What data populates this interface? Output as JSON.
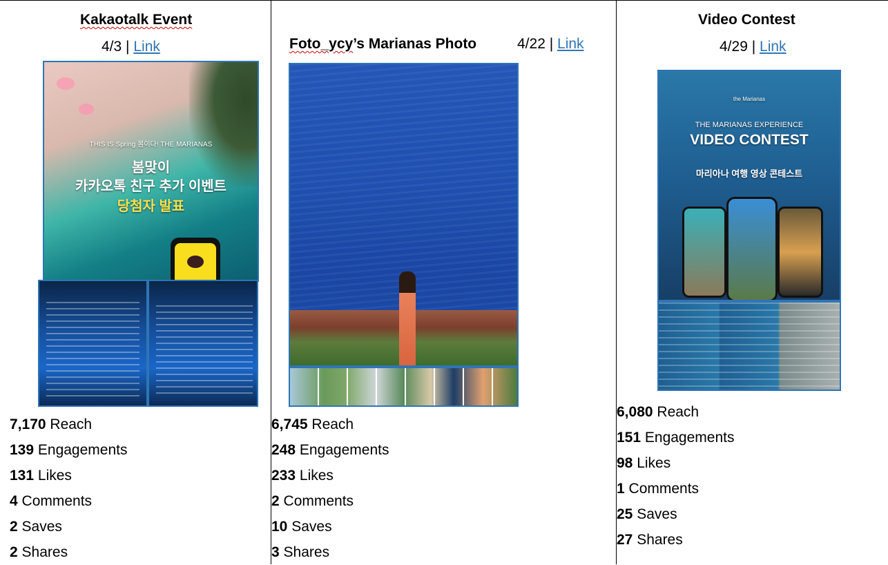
{
  "columns": [
    {
      "title": "Kakaotalk Event",
      "date": "4/3",
      "separator": "|",
      "link_text": "Link",
      "image": {
        "banner_text": "THIS IS Spring 봄이다! THE MARIANAS",
        "line1": "봄맞이",
        "line2": "카카오톡 친구 추가 이벤트",
        "line3": "당첨자 발표"
      },
      "stats": [
        {
          "value": "7,170",
          "label": "Reach"
        },
        {
          "value": "139",
          "label": "Engagements"
        },
        {
          "value": "131",
          "label": "Likes"
        },
        {
          "value": "4",
          "label": "Comments"
        },
        {
          "value": "2",
          "label": "Saves"
        },
        {
          "value": "2",
          "label": "Shares"
        }
      ]
    },
    {
      "title_part1": "Foto_ycy",
      "title_part2": "’s Marianas Photo",
      "date": "4/22",
      "separator": "|",
      "link_text": "Link",
      "stats": [
        {
          "value": "6,745",
          "label": "Reach"
        },
        {
          "value": "248",
          "label": "Engagements"
        },
        {
          "value": "233",
          "label": "Likes"
        },
        {
          "value": "2",
          "label": "Comments"
        },
        {
          "value": "10",
          "label": "Saves"
        },
        {
          "value": "3",
          "label": "Shares"
        }
      ]
    },
    {
      "title": "Video Contest",
      "date": "4/29",
      "separator": "|",
      "link_text": "Link",
      "image": {
        "brand": "the Marianas",
        "headline1": "THE MARIANAS EXPERIENCE",
        "headline2": "VIDEO CONTEST",
        "korean": "마리아나 여행 영상 콘테스트"
      },
      "stats": [
        {
          "value": "6,080",
          "label": "Reach"
        },
        {
          "value": "151",
          "label": "Engagements"
        },
        {
          "value": "98",
          "label": "Likes"
        },
        {
          "value": "1",
          "label": "Comments"
        },
        {
          "value": "25",
          "label": "Saves"
        },
        {
          "value": "27",
          "label": "Shares"
        }
      ]
    }
  ],
  "colors": {
    "link": "#2e74b5",
    "image_border": "#2e75b6",
    "ocean": "#1746a8"
  }
}
